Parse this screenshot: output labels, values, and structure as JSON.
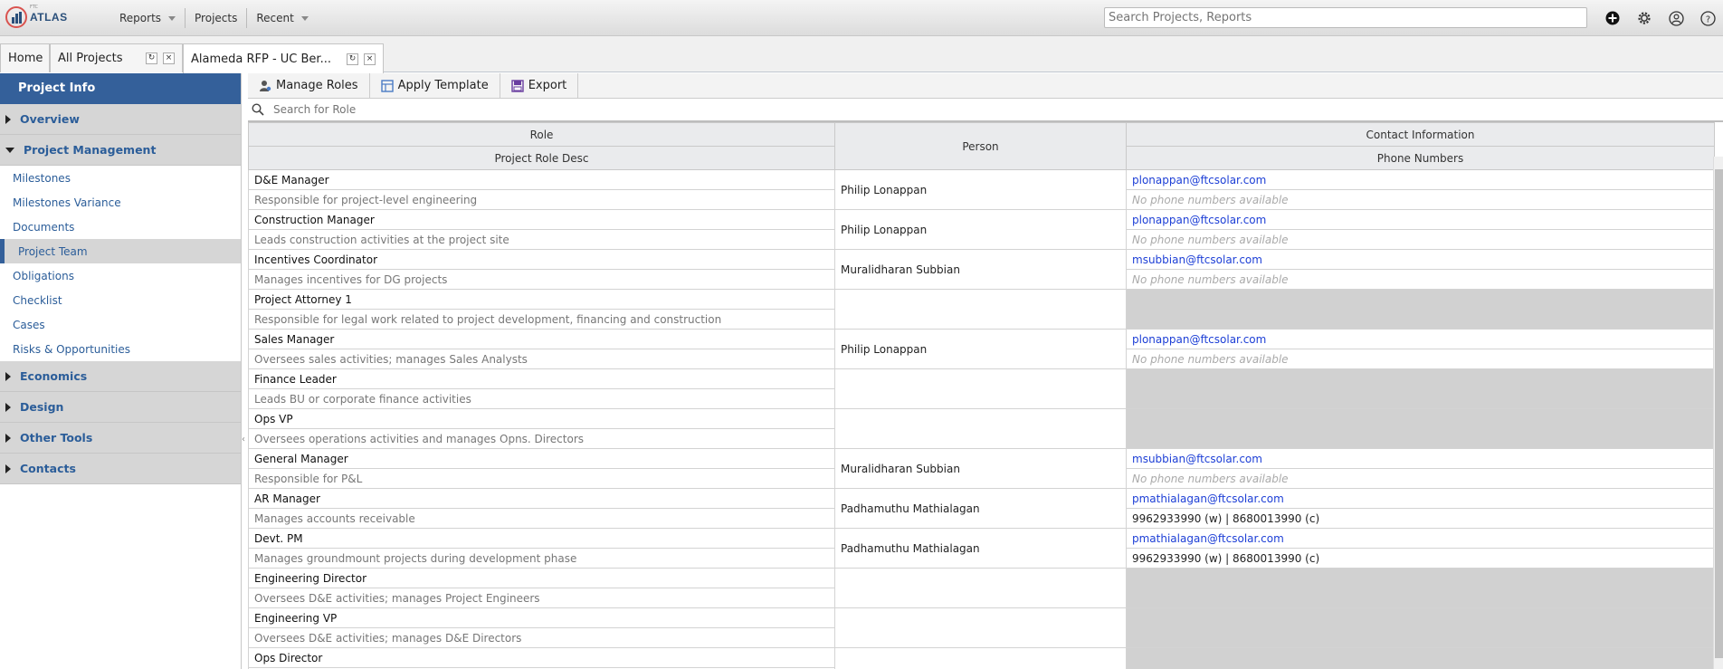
{
  "app": {
    "logo_text": "ATLAS",
    "logo_small": "FTC"
  },
  "nav": {
    "reports": "Reports",
    "projects": "Projects",
    "recent": "Recent"
  },
  "search": {
    "placeholder": "Search Projects, Reports"
  },
  "tabs": [
    {
      "label": "Home"
    },
    {
      "label": "All Projects"
    },
    {
      "label": "Alameda RFP - UC Ber..."
    }
  ],
  "sidebar": {
    "header": "Project Info",
    "groups": {
      "overview": "Overview",
      "project_management": "Project Management",
      "economics": "Economics",
      "design": "Design",
      "other_tools": "Other Tools",
      "contacts": "Contacts"
    },
    "items": [
      "Milestones",
      "Milestones Variance",
      "Documents",
      "Project Team",
      "Obligations",
      "Checklist",
      "Cases",
      "Risks & Opportunities"
    ]
  },
  "toolbar": {
    "manage_roles": "Manage Roles",
    "apply_template": "Apply Template",
    "export": "Export"
  },
  "role_search": {
    "placeholder": "Search for Role"
  },
  "table": {
    "headers": {
      "role": "Role",
      "role_desc": "Project Role Desc",
      "person": "Person",
      "contact": "Contact Information",
      "phones": "Phone Numbers"
    },
    "rows": [
      {
        "role": "D&E Manager",
        "desc": "Responsible for project-level engineering",
        "person": "Philip Lonappan",
        "email": "plonappan@ftcsolar.com",
        "phone": "No phone numbers available"
      },
      {
        "role": "Construction Manager",
        "desc": "Leads construction activities at the project site",
        "person": "Philip Lonappan",
        "email": "plonappan@ftcsolar.com",
        "phone": "No phone numbers available"
      },
      {
        "role": "Incentives Coordinator",
        "desc": "Manages incentives for DG projects",
        "person": "Muralidharan Subbian",
        "email": "msubbian@ftcsolar.com",
        "phone": "No phone numbers available"
      },
      {
        "role": "Project Attorney 1",
        "desc": "Responsible for legal work related to project development, financing and construction",
        "person": "",
        "email": "",
        "phone": ""
      },
      {
        "role": "Sales Manager",
        "desc": "Oversees sales activities; manages Sales Analysts",
        "person": "Philip Lonappan",
        "email": "plonappan@ftcsolar.com",
        "phone": "No phone numbers available"
      },
      {
        "role": "Finance Leader",
        "desc": "Leads BU or corporate finance activities",
        "person": "",
        "email": "",
        "phone": ""
      },
      {
        "role": "Ops VP",
        "desc": "Oversees operations activities and manages Opns. Directors",
        "person": "",
        "email": "",
        "phone": ""
      },
      {
        "role": "General Manager",
        "desc": "Responsible for P&L",
        "person": "Muralidharan Subbian",
        "email": "msubbian@ftcsolar.com",
        "phone": "No phone numbers available"
      },
      {
        "role": "AR Manager",
        "desc": "Manages accounts receivable",
        "person": "Padhamuthu Mathialagan",
        "email": "pmathialagan@ftcsolar.com",
        "phone": "9962933990 (w) | 8680013990 (c)"
      },
      {
        "role": "Devt. PM",
        "desc": "Manages groundmount projects during development phase",
        "person": "Padhamuthu Mathialagan",
        "email": "pmathialagan@ftcsolar.com",
        "phone": "9962933990 (w) | 8680013990 (c)"
      },
      {
        "role": "Engineering Director",
        "desc": "Oversees D&E activities; manages Project Engineers",
        "person": "",
        "email": "",
        "phone": ""
      },
      {
        "role": "Engineering VP",
        "desc": "Oversees D&E activities; manages D&E Directors",
        "person": "",
        "email": "",
        "phone": ""
      },
      {
        "role": "Ops Director",
        "desc": "",
        "person": "",
        "email": "",
        "phone": ""
      }
    ]
  }
}
